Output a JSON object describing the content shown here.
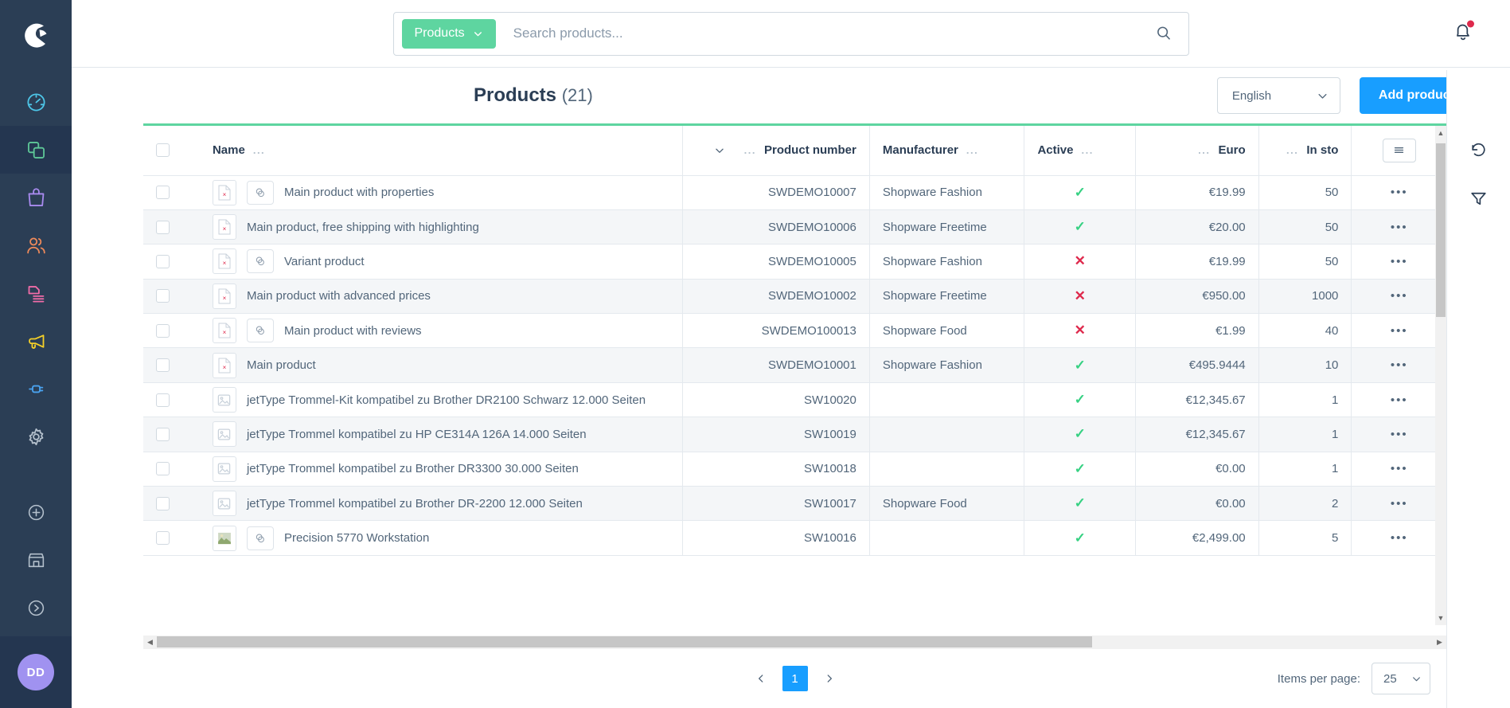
{
  "sidebar": {
    "logo_name": "shopware-logo",
    "items": [
      {
        "name": "dashboard",
        "icon": "gauge-icon",
        "color": "#4dc6e8",
        "active": false
      },
      {
        "name": "catalogues",
        "icon": "copy-icon",
        "color": "#5ec898",
        "active": true
      },
      {
        "name": "orders",
        "icon": "shopping-bag-icon",
        "color": "#a98bf0",
        "active": false
      },
      {
        "name": "customers",
        "icon": "users-icon",
        "color": "#ef8a5a",
        "active": false
      },
      {
        "name": "content",
        "icon": "content-icon",
        "color": "#f06ca8",
        "active": false
      },
      {
        "name": "marketing",
        "icon": "megaphone-icon",
        "color": "#f5d028",
        "active": false
      },
      {
        "name": "extensions",
        "icon": "plug-icon",
        "color": "#4aa3f0",
        "active": false
      },
      {
        "name": "settings",
        "icon": "gear-icon",
        "color": "#b4c0cc",
        "active": false
      }
    ],
    "bottom_items": [
      {
        "name": "add",
        "icon": "plus-circle-icon",
        "color": "#b4c0cc"
      },
      {
        "name": "storefront",
        "icon": "shop-icon",
        "color": "#b4c0cc"
      },
      {
        "name": "expand",
        "icon": "chevron-right-circle-icon",
        "color": "#b4c0cc"
      }
    ],
    "avatar_initials": "DD"
  },
  "search": {
    "scope_label": "Products",
    "scope_chevron": "chevron-down-icon",
    "placeholder": "Search products...",
    "value": "",
    "submit_icon": "search-icon"
  },
  "notifications": {
    "icon": "bell-icon",
    "has_unread": true
  },
  "header": {
    "title": "Products",
    "count": "(21)",
    "language": "English",
    "language_chevron": "chevron-down-icon",
    "add_product_label": "Add product"
  },
  "table": {
    "columns": [
      {
        "key": "checkbox",
        "label": "",
        "align": "left"
      },
      {
        "key": "name",
        "label": "Name",
        "align": "left",
        "menu": "..."
      },
      {
        "key": "product_number",
        "label": "Product number",
        "align": "right",
        "menu": "...",
        "sorted": "chevron-down-icon"
      },
      {
        "key": "manufacturer",
        "label": "Manufacturer",
        "align": "left",
        "menu": "..."
      },
      {
        "key": "active",
        "label": "Active",
        "align": "center",
        "menu": "..."
      },
      {
        "key": "euro",
        "label": "Euro",
        "align": "right",
        "menu": "..."
      },
      {
        "key": "in_stock",
        "label": "In sto",
        "align": "right",
        "menu": "..."
      },
      {
        "key": "actions",
        "label": "",
        "align": "center"
      }
    ],
    "settings_icon": "list-settings-icon",
    "rows": [
      {
        "name": "Main product with properties",
        "thumb": "broken-image-icon",
        "variant_badge": true,
        "product_number": "SWDEMO10007",
        "manufacturer": "Shopware Fashion",
        "active": true,
        "euro": "€19.99",
        "in_stock": "50",
        "actions": "•••"
      },
      {
        "name": "Main product, free shipping with highlighting",
        "thumb": "broken-image-icon",
        "variant_badge": false,
        "product_number": "SWDEMO10006",
        "manufacturer": "Shopware Freetime",
        "active": true,
        "euro": "€20.00",
        "in_stock": "50",
        "actions": "•••"
      },
      {
        "name": "Variant product",
        "thumb": "broken-image-icon",
        "variant_badge": true,
        "product_number": "SWDEMO10005",
        "manufacturer": "Shopware Fashion",
        "active": false,
        "euro": "€19.99",
        "in_stock": "50",
        "actions": "•••"
      },
      {
        "name": "Main product with advanced prices",
        "thumb": "broken-image-icon",
        "variant_badge": false,
        "product_number": "SWDEMO10002",
        "manufacturer": "Shopware Freetime",
        "active": false,
        "euro": "€950.00",
        "in_stock": "1000",
        "actions": "•••"
      },
      {
        "name": "Main product with reviews",
        "thumb": "broken-image-icon",
        "variant_badge": true,
        "product_number": "SWDEMO100013",
        "manufacturer": "Shopware Food",
        "active": false,
        "euro": "€1.99",
        "in_stock": "40",
        "actions": "•••"
      },
      {
        "name": "Main product",
        "thumb": "broken-image-icon",
        "variant_badge": false,
        "product_number": "SWDEMO10001",
        "manufacturer": "Shopware Fashion",
        "active": true,
        "euro": "€495.9444",
        "in_stock": "10",
        "actions": "•••"
      },
      {
        "name": "jetType Trommel-Kit kompatibel zu Brother DR2100 Schwarz 12.000 Seiten",
        "thumb": "image-placeholder-icon",
        "variant_badge": false,
        "product_number": "SW10020",
        "manufacturer": "",
        "active": true,
        "euro": "€12,345.67",
        "in_stock": "1",
        "actions": "•••"
      },
      {
        "name": "jetType Trommel kompatibel zu HP CE314A 126A 14.000 Seiten",
        "thumb": "image-placeholder-icon",
        "variant_badge": false,
        "product_number": "SW10019",
        "manufacturer": "",
        "active": true,
        "euro": "€12,345.67",
        "in_stock": "1",
        "actions": "•••"
      },
      {
        "name": "jetType Trommel kompatibel zu Brother DR3300 30.000 Seiten",
        "thumb": "image-placeholder-icon",
        "variant_badge": false,
        "product_number": "SW10018",
        "manufacturer": "",
        "active": true,
        "euro": "€0.00",
        "in_stock": "1",
        "actions": "•••"
      },
      {
        "name": "jetType Trommel kompatibel zu Brother DR-2200 12.000 Seiten",
        "thumb": "image-placeholder-icon",
        "variant_badge": false,
        "product_number": "SW10017",
        "manufacturer": "Shopware Food",
        "active": true,
        "euro": "€0.00",
        "in_stock": "2",
        "actions": "•••"
      },
      {
        "name": "Precision 5770 Workstation",
        "thumb": "photo-icon",
        "variant_badge": true,
        "product_number": "SW10016",
        "manufacturer": "",
        "active": true,
        "euro": "€2,499.00",
        "in_stock": "5",
        "actions": "•••"
      }
    ]
  },
  "rail": {
    "items": [
      {
        "name": "undo",
        "icon": "undo-icon"
      },
      {
        "name": "filter",
        "icon": "filter-icon"
      }
    ]
  },
  "footer": {
    "prev_icon": "chevron-left-icon",
    "next_icon": "chevron-right-icon",
    "current_page": "1",
    "items_per_page_label": "Items per page:",
    "items_per_page_value": "25",
    "items_per_page_chevron": "chevron-down-icon"
  }
}
